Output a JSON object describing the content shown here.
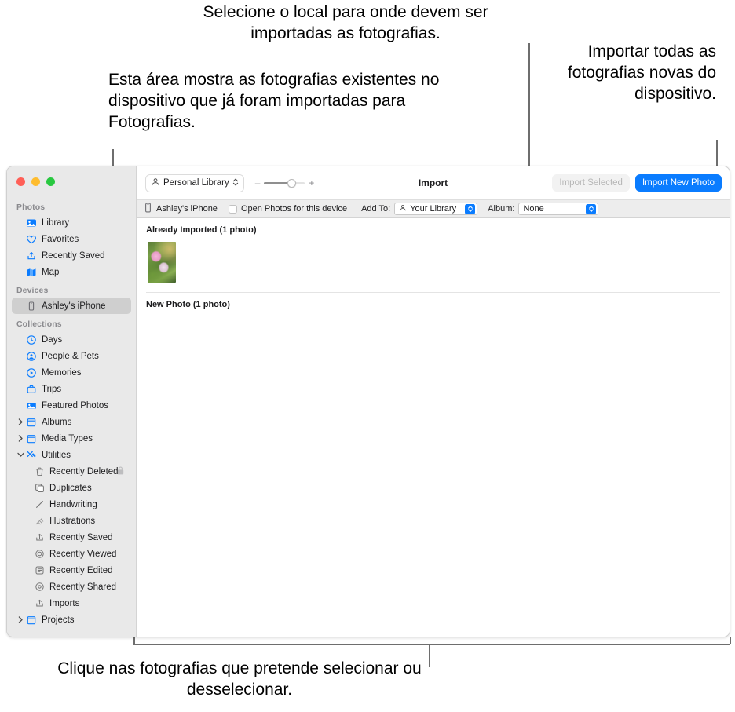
{
  "annotations": {
    "top_center": "Selecione o local para onde devem ser importadas as fotografias.",
    "left": "Esta área mostra as fotografias existentes no dispositivo que já foram importadas para Fotografias.",
    "right": "Importar todas as fotografias novas do dispositivo.",
    "bottom": "Clique nas fotografias que pretende selecionar ou desselecionar."
  },
  "window": {
    "title": "Import",
    "traffic_lights": {
      "close": "close-button",
      "minimize": "minimize-button",
      "zoom": "zoom-button"
    }
  },
  "toolbar": {
    "library_popup": "Personal Library",
    "zoom_minus": "–",
    "zoom_plus": "+",
    "zoom_value": 62,
    "import_selected_label": "Import Selected",
    "import_new_label": "Import New Photo",
    "accent_color": "#0a7cff"
  },
  "subbar": {
    "device_name": "Ashley's iPhone",
    "open_photos_label": "Open Photos for this device",
    "open_photos_checked": false,
    "add_to_label": "Add To:",
    "add_to_value": "Your Library",
    "album_label": "Album:",
    "album_value": "None"
  },
  "sidebar": {
    "groups": [
      {
        "header": "Photos",
        "items": [
          {
            "label": "Library",
            "icon": "library-icon",
            "selected": false
          },
          {
            "label": "Favorites",
            "icon": "heart-icon",
            "selected": false
          },
          {
            "label": "Recently Saved",
            "icon": "save-icon",
            "selected": false
          },
          {
            "label": "Map",
            "icon": "map-icon",
            "selected": false
          }
        ]
      },
      {
        "header": "Devices",
        "items": [
          {
            "label": "Ashley's iPhone",
            "icon": "iphone-icon",
            "selected": true
          }
        ]
      },
      {
        "header": "Collections",
        "items": [
          {
            "label": "Days",
            "icon": "clock-icon",
            "selected": false
          },
          {
            "label": "People & Pets",
            "icon": "person-circle-icon",
            "selected": false
          },
          {
            "label": "Memories",
            "icon": "memories-icon",
            "selected": false
          },
          {
            "label": "Trips",
            "icon": "suitcase-icon",
            "selected": false
          },
          {
            "label": "Featured Photos",
            "icon": "featured-photos-icon",
            "selected": false
          },
          {
            "label": "Albums",
            "icon": "folder-icon",
            "disclosure": "collapsed",
            "selected": false
          },
          {
            "label": "Media Types",
            "icon": "folder-icon",
            "disclosure": "collapsed",
            "selected": false
          },
          {
            "label": "Utilities",
            "icon": "utilities-icon",
            "disclosure": "expanded",
            "selected": false
          },
          {
            "label": "Recently Deleted",
            "icon": "trash-icon",
            "sub": true,
            "badge": "lock-icon",
            "selected": false
          },
          {
            "label": "Duplicates",
            "icon": "duplicates-icon",
            "sub": true,
            "selected": false
          },
          {
            "label": "Handwriting",
            "icon": "handwriting-icon",
            "sub": true,
            "selected": false
          },
          {
            "label": "Illustrations",
            "icon": "illustrations-icon",
            "sub": true,
            "selected": false
          },
          {
            "label": "Recently Saved",
            "icon": "save-icon",
            "sub": true,
            "selected": false
          },
          {
            "label": "Recently Viewed",
            "icon": "recently-viewed-icon",
            "sub": true,
            "selected": false
          },
          {
            "label": "Recently Edited",
            "icon": "recently-edited-icon",
            "sub": true,
            "selected": false
          },
          {
            "label": "Recently Shared",
            "icon": "recently-shared-icon",
            "sub": true,
            "selected": false
          },
          {
            "label": "Imports",
            "icon": "import-icon",
            "sub": true,
            "selected": false
          },
          {
            "label": "Projects",
            "icon": "folder-icon",
            "disclosure": "collapsed",
            "selected": false
          }
        ]
      }
    ]
  },
  "content": {
    "sections": [
      {
        "title": "Already Imported (1 photo)",
        "photos": [
          {
            "name": "photo-thumbnail-pink-flowers",
            "style": "flower-pink",
            "size": "small"
          }
        ]
      },
      {
        "title": "New Photo (1 photo)",
        "photos": [
          {
            "name": "photo-thumbnail-orange-flowers",
            "style": "flower-orange",
            "size": "large"
          }
        ]
      }
    ]
  }
}
